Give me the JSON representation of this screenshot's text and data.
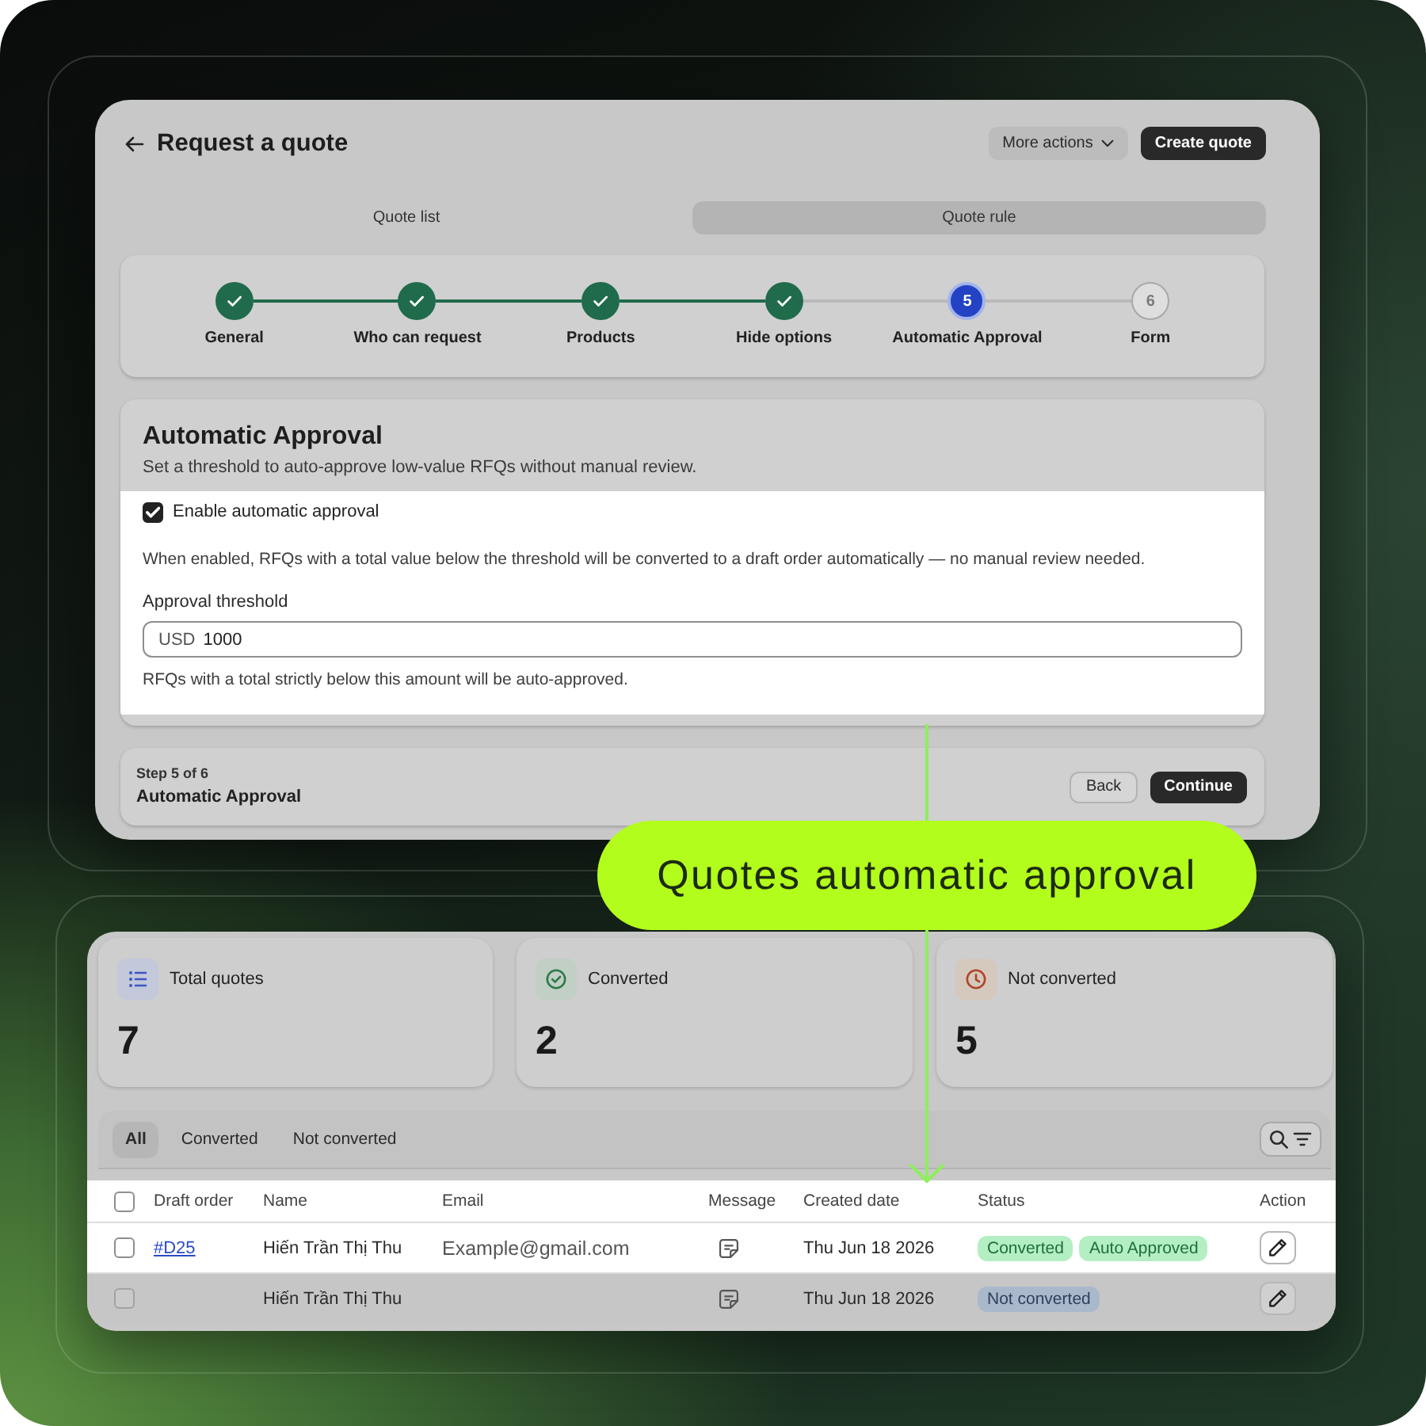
{
  "callout": {
    "label": "Quotes automatic approval"
  },
  "quote_page": {
    "title": "Request a quote",
    "actions": [
      {
        "label": "More actions",
        "kind": "menu"
      },
      {
        "label": "Create quote",
        "kind": "primary"
      }
    ],
    "tabs": [
      {
        "label": "Quote list",
        "selected": false
      },
      {
        "label": "Quote rule",
        "selected": true
      }
    ],
    "steps": [
      {
        "label": "General",
        "completed": true,
        "current": false
      },
      {
        "label": "Who can request",
        "completed": true,
        "current": false
      },
      {
        "label": "Products",
        "completed": true,
        "current": false
      },
      {
        "label": "Hide options",
        "completed": true,
        "current": false
      },
      {
        "label": "Automatic Approval",
        "completed": false,
        "current": true,
        "number": "5"
      },
      {
        "label": "Form",
        "completed": false,
        "current": false,
        "number": "6"
      }
    ],
    "section": {
      "title": "Automatic Approval",
      "subtitle": "Set a threshold to auto-approve low-value RFQs without manual review.",
      "highlighted": true,
      "checkbox": {
        "label": "Enable automatic approval",
        "checked": true
      },
      "description": "When enabled, RFQs with a total value below the threshold will be converted to a draft order automatically — no manual review needed.",
      "threshold": {
        "label": "Approval threshold",
        "prefix": "USD",
        "value": "1000",
        "help": "RFQs with a total strictly below this amount will be auto-approved."
      }
    },
    "footer": {
      "step": "Step 5 of 6",
      "title": "Automatic Approval",
      "buttons": [
        {
          "label": "Back",
          "kind": "secondary"
        },
        {
          "label": "Continue",
          "kind": "primary"
        }
      ]
    }
  },
  "quotes_dashboard": {
    "stats": [
      {
        "kind": "total",
        "label": "Total quotes",
        "value": "7"
      },
      {
        "kind": "converted",
        "label": "Converted",
        "value": "2"
      },
      {
        "kind": "not_converted",
        "label": "Not converted",
        "value": "5"
      }
    ],
    "filter_tabs": [
      {
        "label": "All",
        "selected": true
      },
      {
        "label": "Converted",
        "selected": false
      },
      {
        "label": "Not converted",
        "selected": false
      }
    ],
    "table": {
      "select_all_checked": false,
      "columns": [
        "Draft order",
        "Name",
        "Email",
        "Message",
        "Created date",
        "Status",
        "Action"
      ],
      "rows": [
        {
          "checked": false,
          "highlighted": true,
          "draft_order": "#D25",
          "name": "Hiến Trần Thị Thu",
          "email": "Example@gmail.com",
          "created_date": "Thu Jun 18 2026",
          "statuses": [
            {
              "label": "Converted",
              "kind": "success"
            },
            {
              "label": "Auto Approved",
              "kind": "success"
            }
          ]
        },
        {
          "checked": false,
          "highlighted": false,
          "name": "Hiến Trần Thị Thu",
          "created_date": "Thu Jun 18 2026",
          "statuses": [
            {
              "label": "Not converted",
              "kind": "neutral"
            }
          ]
        }
      ]
    }
  }
}
